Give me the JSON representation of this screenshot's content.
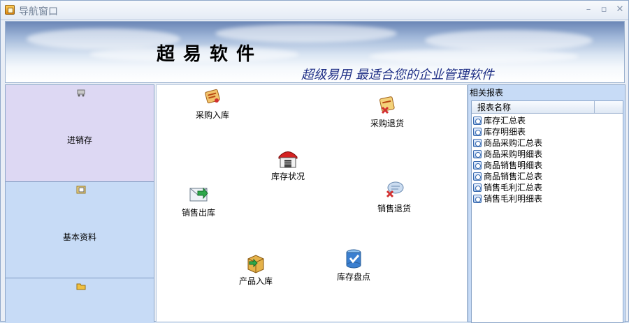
{
  "window": {
    "title": "导航窗口",
    "minimize": "–",
    "maximize": "▫",
    "close": "✕"
  },
  "banner": {
    "title": "超易软件",
    "slogan": "超级易用 最适合您的企业管理软件"
  },
  "leftnav": {
    "items": [
      {
        "label": "进销存",
        "icon": "cart-icon"
      },
      {
        "label": "基本资料",
        "icon": "document-icon"
      },
      {
        "label": "",
        "icon": "folder-icon"
      }
    ]
  },
  "functions": [
    {
      "label": "采购入库",
      "icon": "purchase-in-icon"
    },
    {
      "label": "采购退货",
      "icon": "purchase-return-icon"
    },
    {
      "label": "库存状况",
      "icon": "warehouse-icon"
    },
    {
      "label": "销售出库",
      "icon": "sales-out-icon"
    },
    {
      "label": "销售退货",
      "icon": "sales-return-icon"
    },
    {
      "label": "产品入库",
      "icon": "product-in-icon"
    },
    {
      "label": "库存盘点",
      "icon": "stocktake-icon"
    }
  ],
  "reports": {
    "panel_title": "相关报表",
    "column_header": "报表名称",
    "items": [
      "库存汇总表",
      "库存明细表",
      "商品采购汇总表",
      "商品采购明细表",
      "商品销售明细表",
      "商品销售汇总表",
      "销售毛利汇总表",
      "销售毛利明细表"
    ]
  }
}
